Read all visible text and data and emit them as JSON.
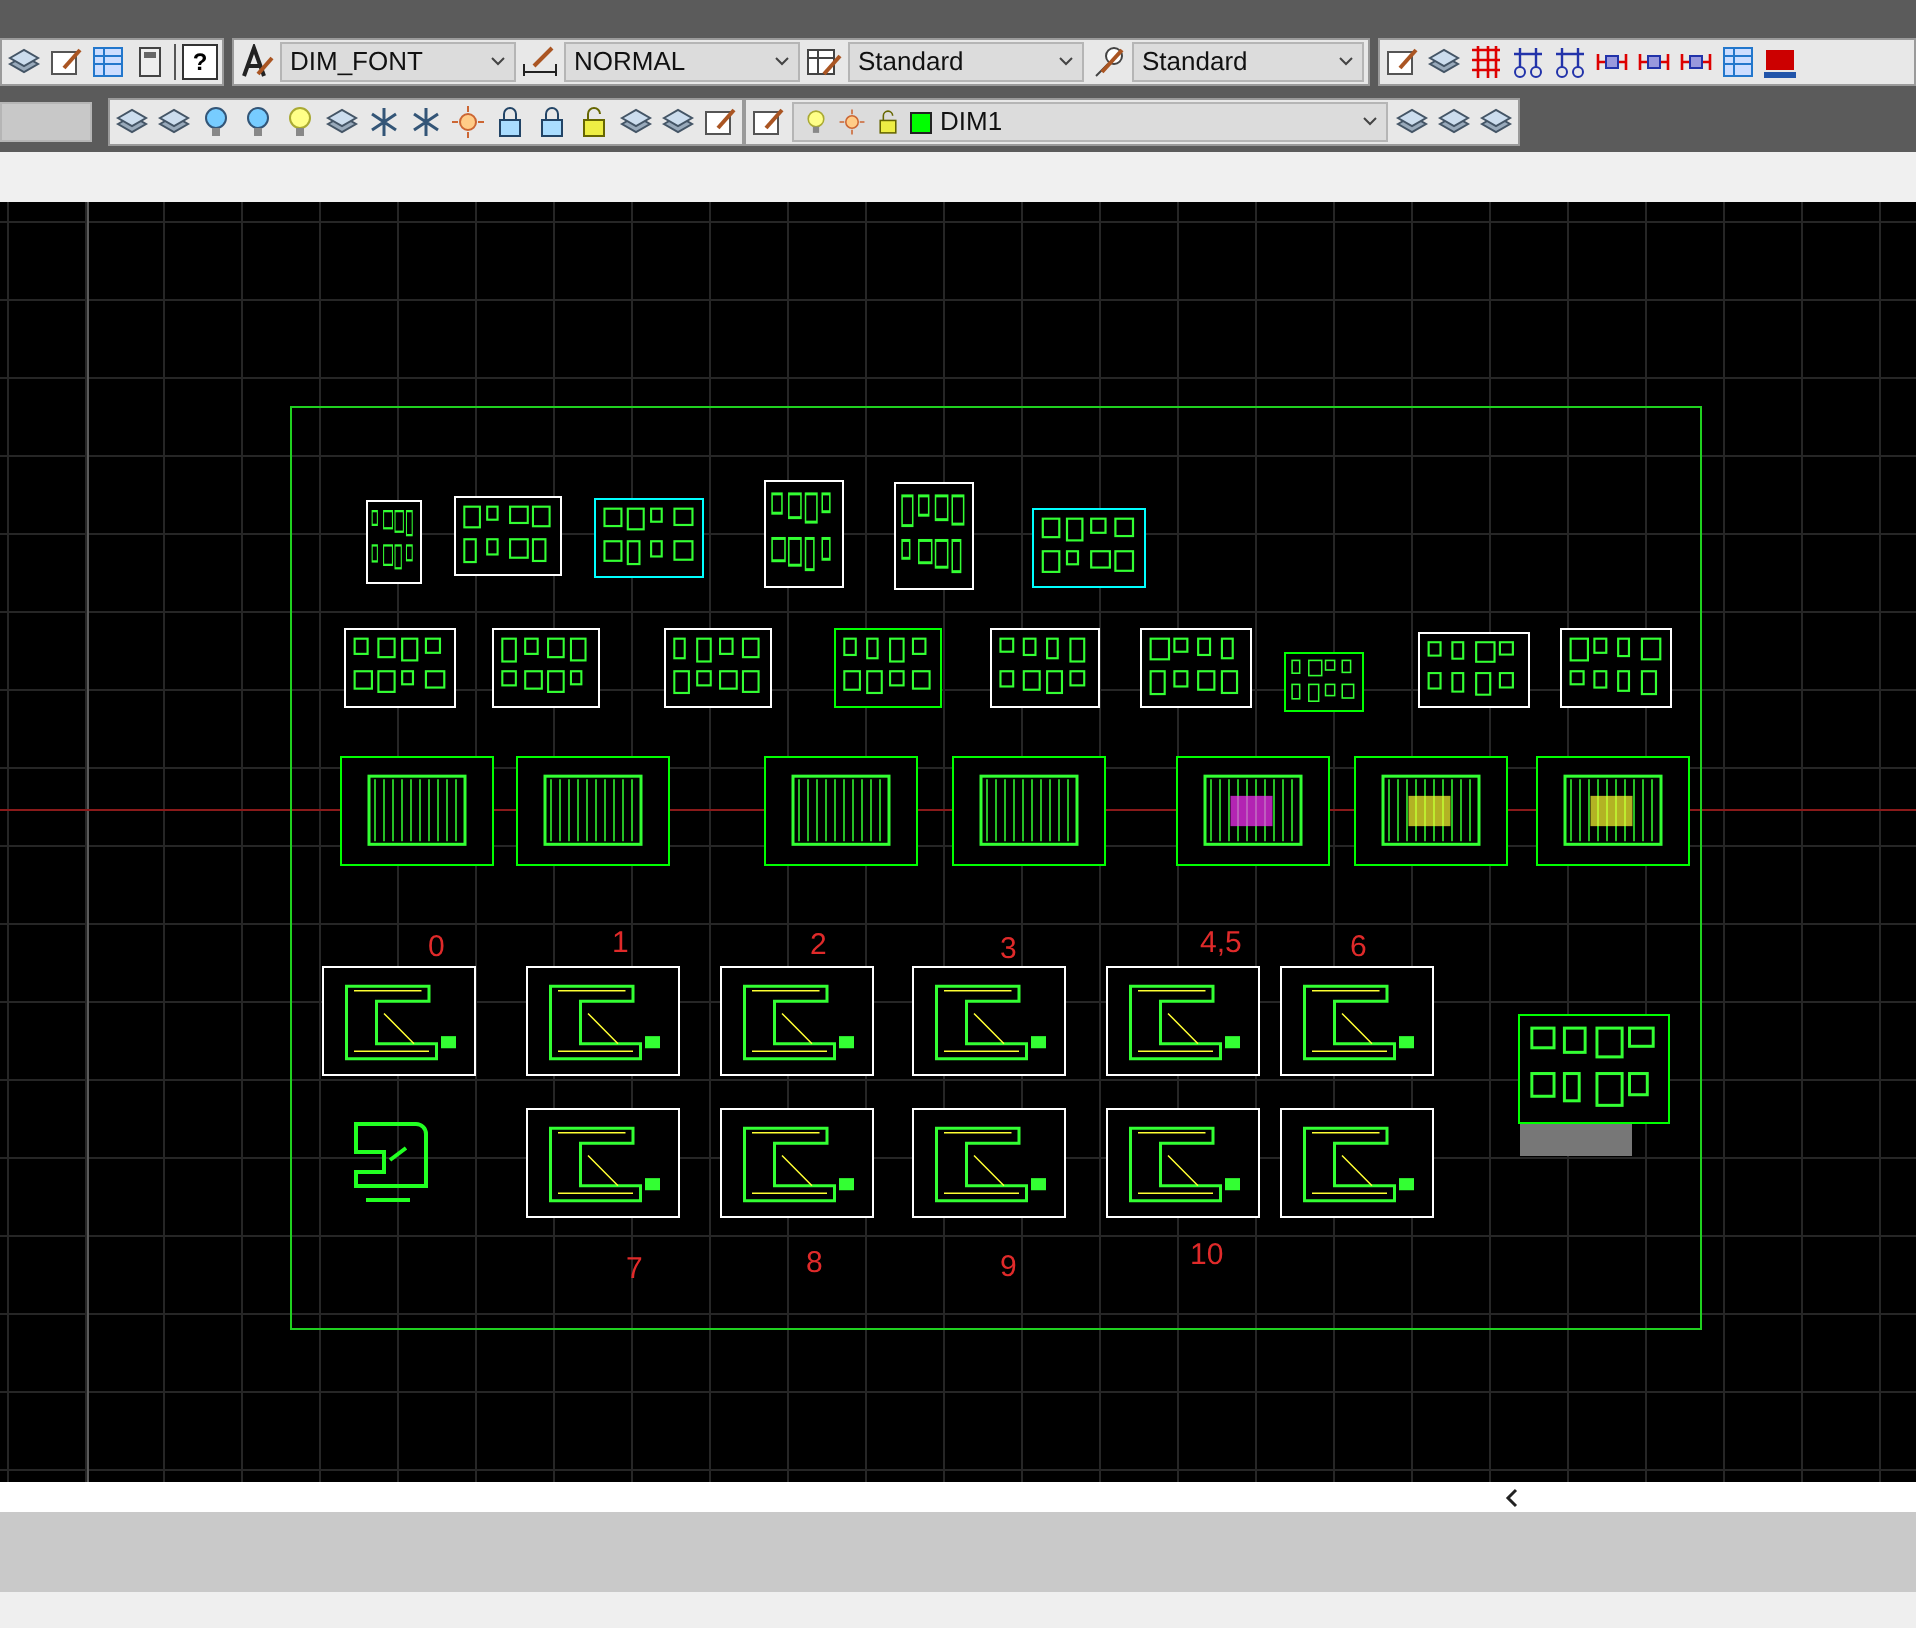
{
  "toolbar_top": {
    "help_key": "?",
    "text_style": "DIM_FONT",
    "dimension_style": "NORMAL",
    "table_style": "Standard",
    "multileader_style": "Standard"
  },
  "toolbar_layers": {
    "current_layer": {
      "name": "DIM1",
      "color": "#00ff00"
    }
  },
  "sheets": [
    {
      "color": "#ffffff"
    },
    {
      "color": "#ffffff"
    },
    {
      "color": "#00ffff"
    },
    {
      "color": "#ffffff"
    },
    {
      "color": "#ffffff"
    },
    {
      "color": "#00ffff"
    },
    {
      "color": "#ffffff"
    },
    {
      "color": "#ffffff"
    },
    {
      "color": "#ffffff"
    },
    {
      "color": "#00ff00"
    },
    {
      "color": "#ffffff"
    },
    {
      "color": "#ffffff"
    },
    {
      "color": "#00ff00"
    },
    {
      "color": "#ffffff"
    },
    {
      "color": "#ffffff"
    },
    {
      "color": "#00ff00"
    },
    {
      "color": "#00ff00"
    },
    {
      "color": "#00ff00"
    },
    {
      "color": "#00ff00"
    },
    {
      "color": "#00ff00"
    },
    {
      "color": "#00ff00"
    },
    {
      "color": "#00ff00"
    },
    {
      "color": "#ffffff"
    },
    {
      "color": "#ffffff"
    },
    {
      "color": "#ffffff"
    },
    {
      "color": "#ffffff"
    },
    {
      "color": "#ffffff"
    },
    {
      "color": "#ffffff"
    },
    {
      "color": "#ffffff"
    },
    {
      "color": "#ffffff"
    },
    {
      "color": "#ffffff"
    },
    {
      "color": "#ffffff"
    },
    {
      "color": "#ffffff"
    },
    {
      "color": "#00ff00"
    }
  ],
  "sheet_labels": [
    "0",
    "1",
    "2",
    "3",
    "4,5",
    "6",
    "7",
    "8",
    "9",
    "10"
  ]
}
